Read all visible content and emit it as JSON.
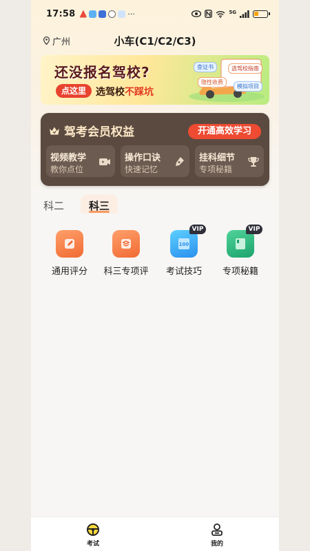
{
  "status_bar": {
    "time": "17:58",
    "right_text": "5G"
  },
  "header": {
    "location": "广州",
    "title": "小车(C1/C2/C3)"
  },
  "banner": {
    "headline": "还没报名驾校?",
    "button": "点这里",
    "sub_prefix": "选驾校",
    "sub_highlight": "不踩坑",
    "tags": [
      "查证书",
      "选驾校指南",
      "隐性收费",
      "模拟项目"
    ]
  },
  "member": {
    "title": "驾考会员权益",
    "cta": "开通高效学习",
    "perks": [
      {
        "title": "视频教学",
        "subtitle": "教你点位",
        "icon": "video-icon"
      },
      {
        "title": "操作口诀",
        "subtitle": "快速记忆",
        "icon": "pen-icon"
      },
      {
        "title": "挂科细节",
        "subtitle": "专项秘籍",
        "icon": "trophy-icon"
      }
    ]
  },
  "tabs": [
    {
      "label": "科二",
      "active": false
    },
    {
      "label": "科三",
      "active": true
    }
  ],
  "features": [
    {
      "label": "通用评分",
      "icon": "edit-doc-icon",
      "vip": false,
      "color": "#f16a33"
    },
    {
      "label": "科三专项评",
      "icon": "layers-icon",
      "vip": false,
      "color": "#f16a33"
    },
    {
      "label": "考试技巧",
      "icon": "score-card-icon",
      "vip": true,
      "vip_label": "VIP",
      "color": "#2a90ee"
    },
    {
      "label": "专项秘籍",
      "icon": "book-icon",
      "vip": true,
      "vip_label": "VIP",
      "color": "#1da36c"
    }
  ],
  "bottom_nav": [
    {
      "label": "考试",
      "icon": "steering-wheel-icon",
      "active": true
    },
    {
      "label": "我的",
      "icon": "profile-icon",
      "active": false
    }
  ],
  "colors": {
    "accent_red": "#ee4b32",
    "member_bg": "#5b4a40",
    "member_gold": "#fbe7c6"
  }
}
